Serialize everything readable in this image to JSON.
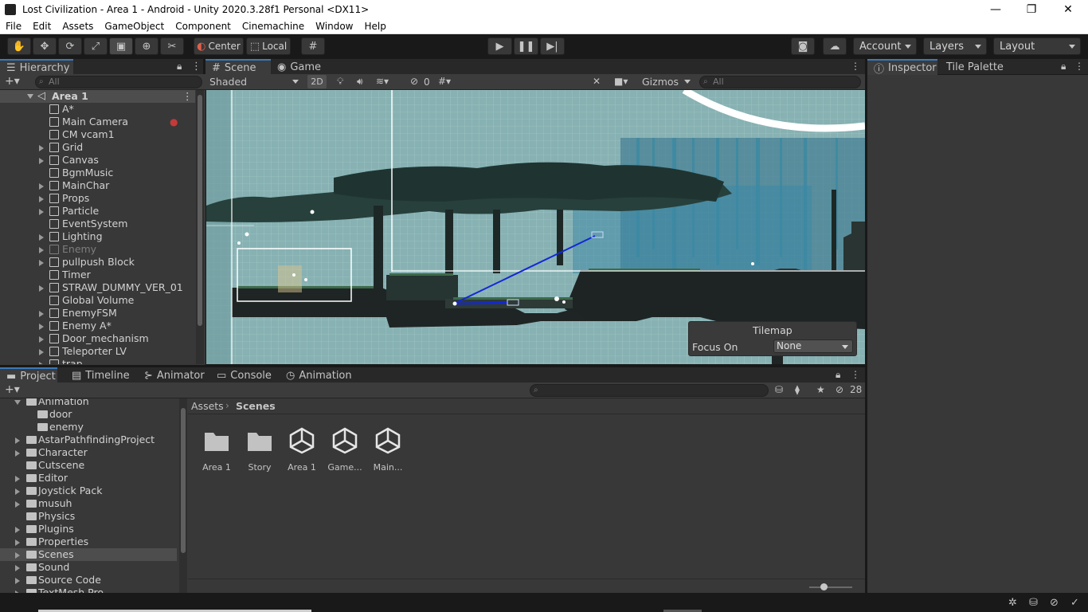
{
  "window": {
    "title": "Lost Civilization - Area 1 - Android - Unity 2020.3.28f1 Personal <DX11>",
    "minimize": "—",
    "maximize": "❐",
    "close": "✕"
  },
  "menu": [
    "File",
    "Edit",
    "Assets",
    "GameObject",
    "Component",
    "Cinemachine",
    "Window",
    "Help"
  ],
  "toolbar": {
    "pivot_label": "Center",
    "space_label": "Local",
    "account_label": "Account",
    "layers_label": "Layers",
    "layout_label": "Layout"
  },
  "hierarchy": {
    "tab_label": "Hierarchy",
    "search_placeholder": "All",
    "scene_name": "Area 1",
    "items": [
      {
        "label": "A*",
        "expandable": false,
        "dim": false
      },
      {
        "label": "Main Camera",
        "expandable": false,
        "dim": false
      },
      {
        "label": "CM vcam1",
        "expandable": false,
        "dim": false
      },
      {
        "label": "Grid",
        "expandable": true,
        "dim": false
      },
      {
        "label": "Canvas",
        "expandable": true,
        "dim": false
      },
      {
        "label": "BgmMusic",
        "expandable": false,
        "dim": false
      },
      {
        "label": "MainChar",
        "expandable": true,
        "dim": false
      },
      {
        "label": "Props",
        "expandable": true,
        "dim": false
      },
      {
        "label": "Particle",
        "expandable": true,
        "dim": false
      },
      {
        "label": "EventSystem",
        "expandable": false,
        "dim": false
      },
      {
        "label": "Lighting",
        "expandable": true,
        "dim": false
      },
      {
        "label": "Enemy",
        "expandable": true,
        "dim": true
      },
      {
        "label": "pullpush Block",
        "expandable": true,
        "dim": false
      },
      {
        "label": "Timer",
        "expandable": false,
        "dim": false
      },
      {
        "label": "STRAW_DUMMY_VER_01",
        "expandable": true,
        "dim": false
      },
      {
        "label": "Global Volume",
        "expandable": false,
        "dim": false
      },
      {
        "label": "EnemyFSM",
        "expandable": true,
        "dim": false
      },
      {
        "label": "Enemy A*",
        "expandable": true,
        "dim": false
      },
      {
        "label": "Door_mechanism",
        "expandable": true,
        "dim": false
      },
      {
        "label": "Teleporter LV",
        "expandable": true,
        "dim": false
      },
      {
        "label": "trap",
        "expandable": true,
        "dim": false
      }
    ]
  },
  "scene_view": {
    "tabs": [
      "Scene",
      "Game"
    ],
    "shading_mode": "Shaded",
    "mode_2d": "2D",
    "hidden_count": "0",
    "gizmos_label": "Gizmos",
    "search_placeholder": "All",
    "overlay": {
      "title": "Tilemap",
      "focus_label": "Focus On",
      "focus_value": "None"
    }
  },
  "inspector": {
    "tabs": [
      "Inspector",
      "Tile Palette"
    ]
  },
  "bottom": {
    "tabs": [
      "Project",
      "Timeline",
      "Animator",
      "Console",
      "Animation"
    ],
    "hidden_packages": "28",
    "breadcrumb": [
      "Assets",
      "Scenes"
    ],
    "folders": [
      {
        "label": "Animation",
        "indent": 1,
        "expanded": true,
        "sel": false
      },
      {
        "label": "door",
        "indent": 2,
        "expandable": false,
        "sel": false
      },
      {
        "label": "enemy",
        "indent": 2,
        "expandable": false,
        "sel": false
      },
      {
        "label": "AstarPathfindingProject",
        "indent": 1,
        "expandable": true,
        "sel": false
      },
      {
        "label": "Character",
        "indent": 1,
        "expandable": true,
        "sel": false
      },
      {
        "label": "Cutscene",
        "indent": 1,
        "expandable": false,
        "sel": false
      },
      {
        "label": "Editor",
        "indent": 1,
        "expandable": true,
        "sel": false
      },
      {
        "label": "Joystick Pack",
        "indent": 1,
        "expandable": true,
        "sel": false
      },
      {
        "label": "musuh",
        "indent": 1,
        "expandable": true,
        "sel": false
      },
      {
        "label": "Physics",
        "indent": 1,
        "expandable": false,
        "sel": false
      },
      {
        "label": "Plugins",
        "indent": 1,
        "expandable": true,
        "sel": false
      },
      {
        "label": "Properties",
        "indent": 1,
        "expandable": true,
        "sel": false
      },
      {
        "label": "Scenes",
        "indent": 1,
        "expandable": true,
        "sel": true
      },
      {
        "label": "Sound",
        "indent": 1,
        "expandable": true,
        "sel": false
      },
      {
        "label": "Source Code",
        "indent": 1,
        "expandable": true,
        "sel": false
      },
      {
        "label": "TextMesh Pro",
        "indent": 1,
        "expandable": true,
        "sel": false
      }
    ],
    "assets": [
      {
        "label": "Area 1",
        "kind": "folder"
      },
      {
        "label": "Story",
        "kind": "folder"
      },
      {
        "label": "Area 1",
        "kind": "scene"
      },
      {
        "label": "Game...",
        "kind": "scene"
      },
      {
        "label": "Main...",
        "kind": "scene"
      }
    ]
  },
  "colors": {
    "accent": "#3a79bb",
    "scene_sky": "#87b1b3",
    "panel": "#383838"
  }
}
